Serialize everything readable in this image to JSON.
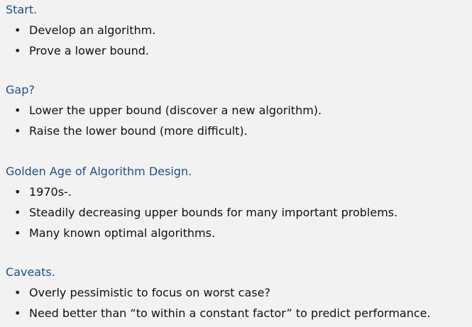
{
  "sections": [
    {
      "heading": "Start.",
      "bullets": [
        "Develop an algorithm.",
        "Prove a lower bound."
      ]
    },
    {
      "heading": "Gap?",
      "bullets": [
        "Lower the upper bound (discover a new algorithm).",
        "Raise the lower bound (more difficult)."
      ]
    },
    {
      "heading": "Golden Age of Algorithm Design.",
      "bullets": [
        "1970s-.",
        "Steadily decreasing upper bounds for many important problems.",
        "Many known optimal algorithms."
      ]
    },
    {
      "heading": "Caveats.",
      "bullets": [
        "Overly pessimistic to focus on worst case?",
        "Need better than “to within a constant factor” to predict performance."
      ]
    }
  ],
  "colors": {
    "background": "#f2f2f2",
    "heading": "#1f4f86",
    "text": "#111111"
  },
  "bullet_glyph": "•"
}
